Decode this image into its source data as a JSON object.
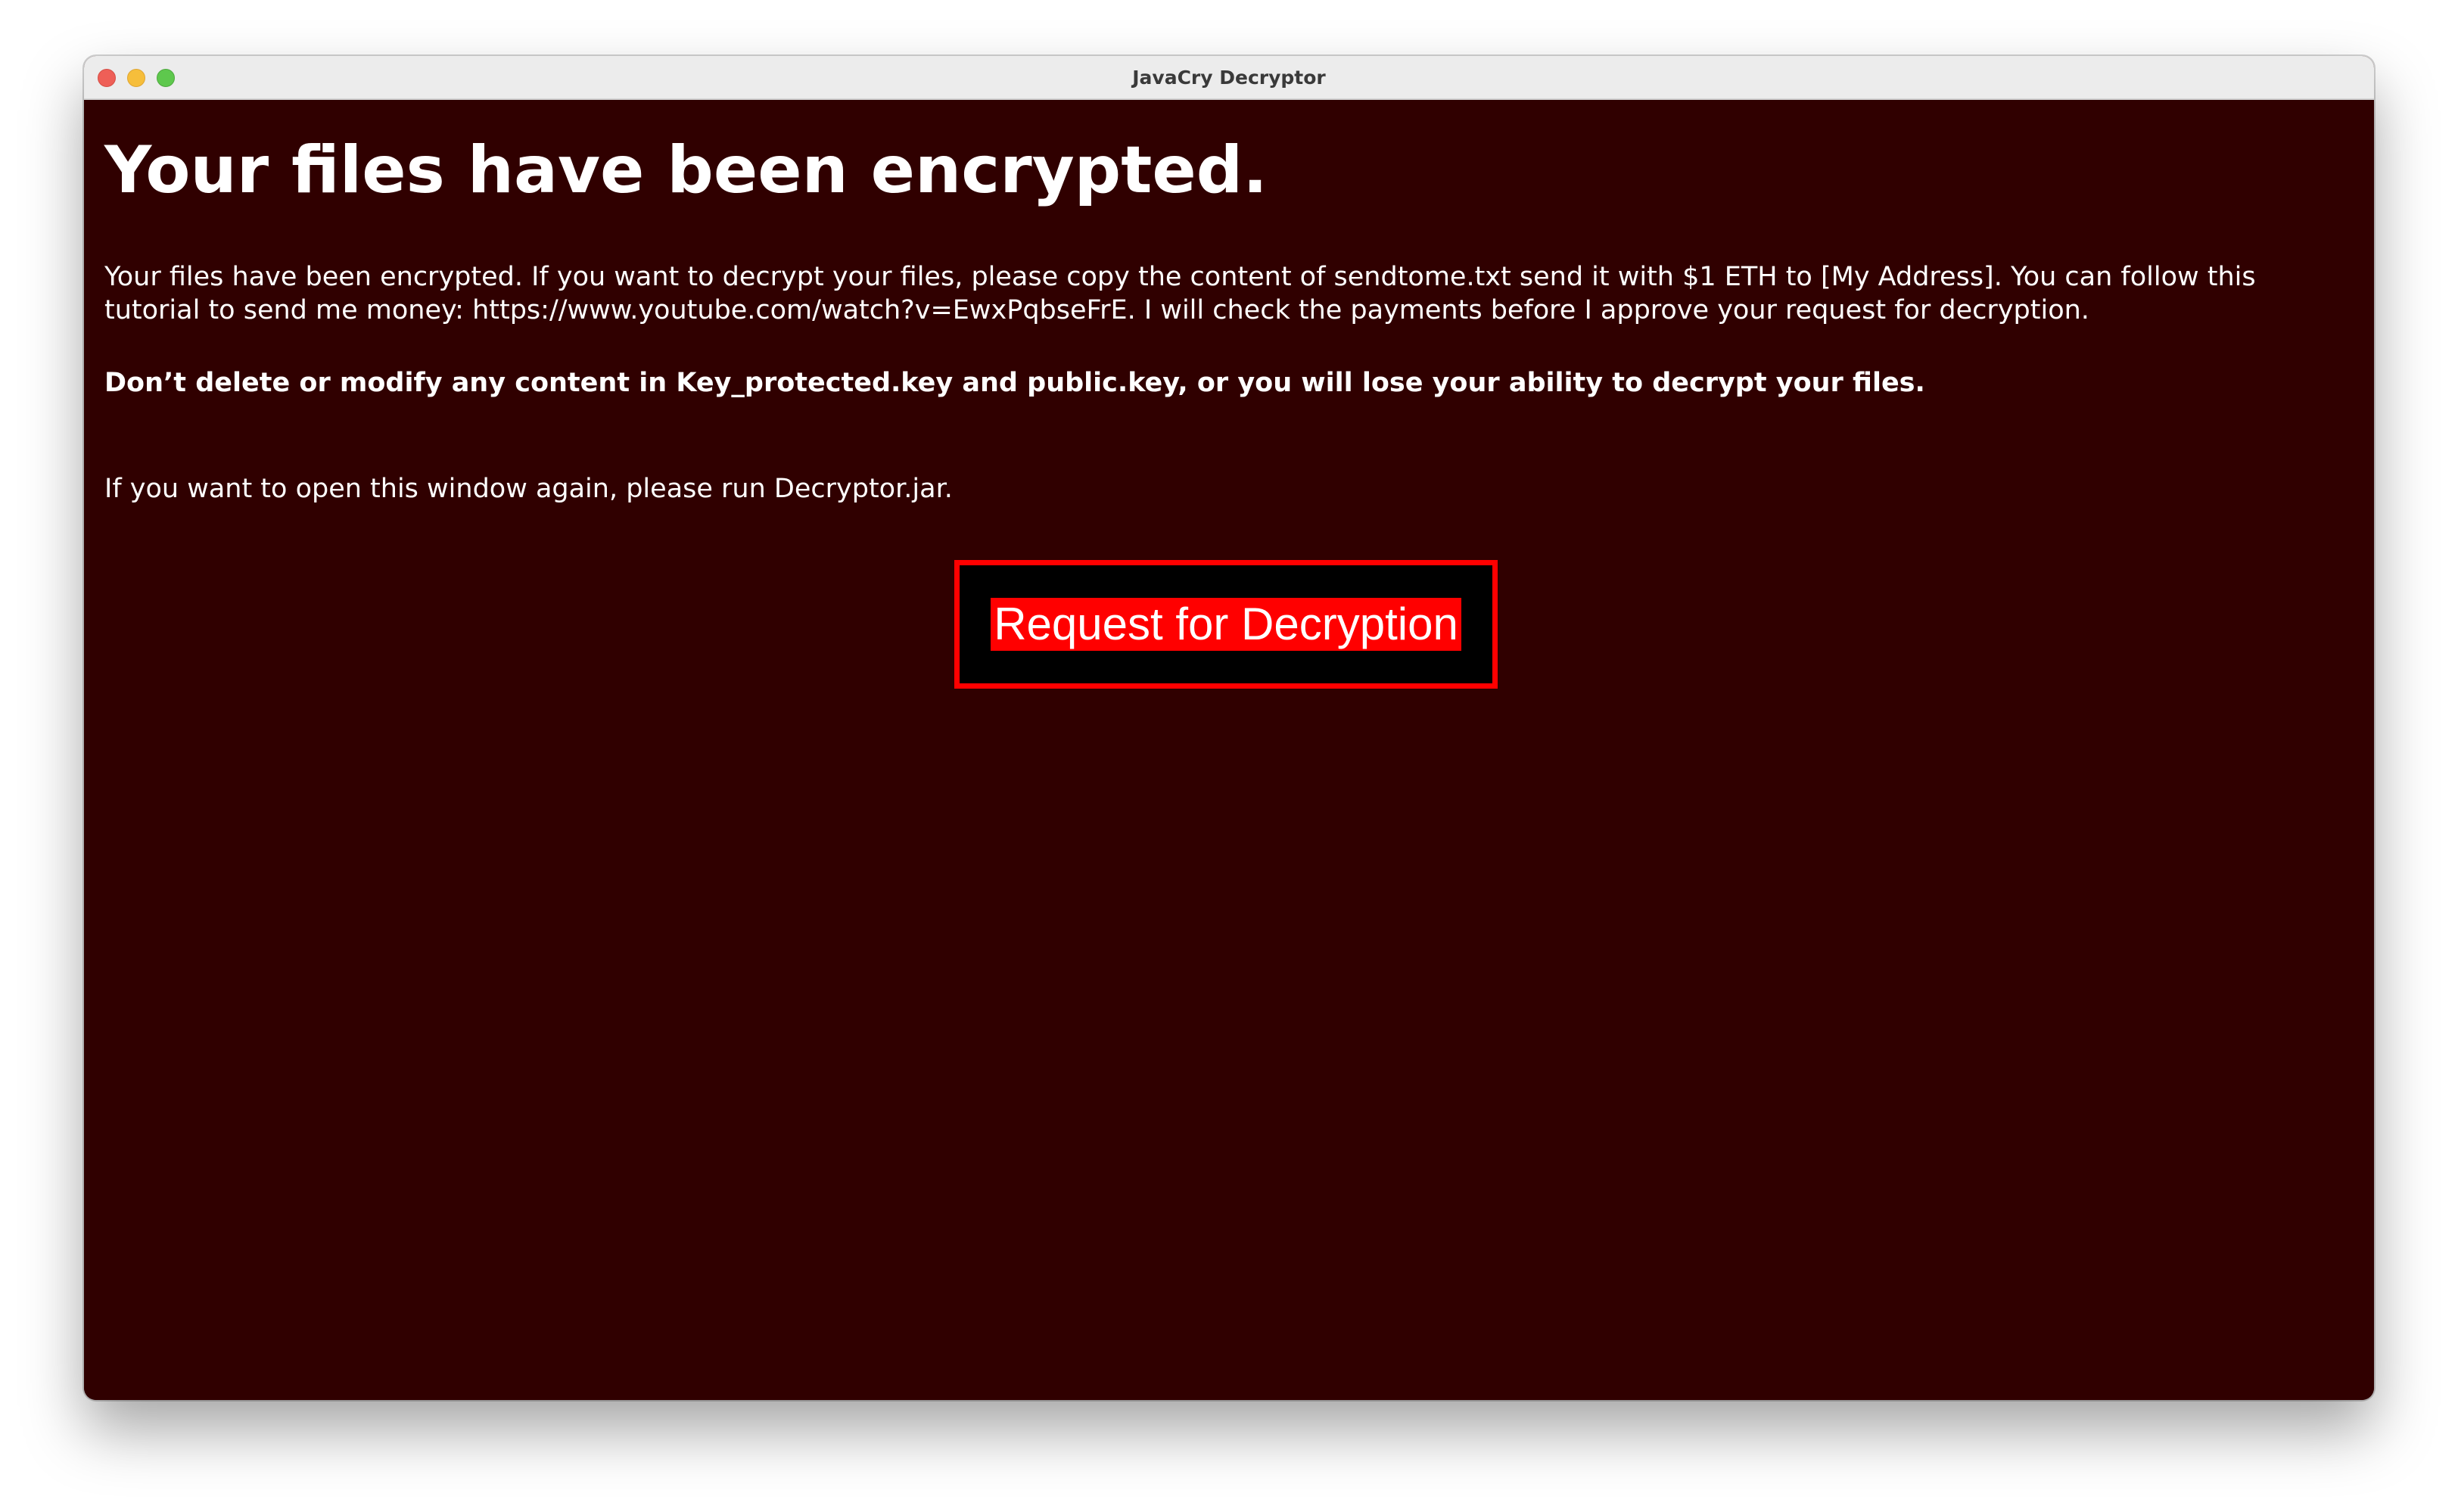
{
  "window": {
    "title": "JavaCry Decryptor"
  },
  "content": {
    "headline": "Your files have been encrypted.",
    "paragraph_1": "Your files have been encrypted. If you want to decrypt your files, please copy the content of sendtome.txt send it with $1 ETH to [My Address]. You can follow this tutorial to send me money: https://www.youtube.com/watch?v=EwxPqbseFrE. I will check the payments before I approve your request for decryption.",
    "paragraph_2": "Don’t delete or modify any content in Key_protected.key and public.key, or you will lose your ability to decrypt your files.",
    "paragraph_3": "If you want to open this window again, please run Decryptor.jar.",
    "request_button_label": "Request for Decryption"
  },
  "colors": {
    "background": "#300000",
    "text": "#ffffff",
    "button_border": "#ff0000",
    "button_fill": "#000000",
    "button_label_highlight": "#ff0000"
  },
  "icons": {
    "close": "close-icon",
    "minimize": "minimize-icon",
    "maximize": "maximize-icon"
  }
}
